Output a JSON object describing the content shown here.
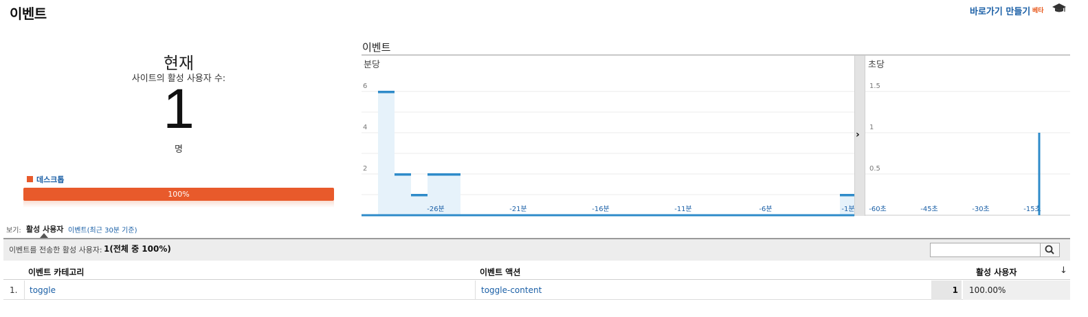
{
  "header": {
    "title": "이벤트",
    "shortcut_label": "바로가기 만들기",
    "beta_label": "베타"
  },
  "summary": {
    "now_label": "현재",
    "site_users_label": "사이트의 활성 사용자 수:",
    "active_count": "1",
    "unit": "명",
    "device_label": "데스크톱",
    "device_percent_text": "100%",
    "device_share": 1.0
  },
  "chart_title": "이벤트",
  "chart_data": [
    {
      "type": "bar",
      "subtitle": "분당",
      "x_ticks": [
        "-26분",
        "-21분",
        "-16분",
        "-11분",
        "-6분",
        "-1분"
      ],
      "y_ticks": [
        "2",
        "4",
        "6"
      ],
      "ylim": [
        0,
        6.8
      ],
      "values": [
        0,
        6,
        2,
        1,
        2,
        2,
        0,
        0,
        0,
        0,
        0,
        0,
        0,
        0,
        0,
        0,
        0,
        0,
        0,
        0,
        0,
        0,
        0,
        0,
        0,
        0,
        0,
        0,
        0,
        1
      ],
      "grid": true
    },
    {
      "type": "bar",
      "subtitle": "초당",
      "x_ticks": [
        "-60초",
        "-45초",
        "-30초",
        "-15초"
      ],
      "y_ticks": [
        "0.5",
        "1",
        "1.5"
      ],
      "ylim": [
        0,
        1.7
      ],
      "spikes": [
        {
          "seconds_ago": 13,
          "value": 1
        }
      ],
      "grid": true
    }
  ],
  "view": {
    "label": "보기:",
    "active_option": "활성 사용자",
    "other_option": "이벤트(최근 30분 기준)"
  },
  "summary_bar": {
    "label": "이벤트를 전송한 활성 사용자:",
    "value": "1(전체 중 100%)"
  },
  "table": {
    "headers": [
      "이벤트 카테고리",
      "이벤트 액션",
      "활성 사용자"
    ],
    "rows": [
      {
        "index": "1.",
        "category": "toggle",
        "action": "toggle-content",
        "users": "1",
        "percent": "100.00%"
      }
    ]
  },
  "colors": {
    "accent": "#1a5fa6",
    "bar": "#2e8bc9",
    "bar_fill": "#e6f2fa",
    "device": "#e85a2b"
  }
}
